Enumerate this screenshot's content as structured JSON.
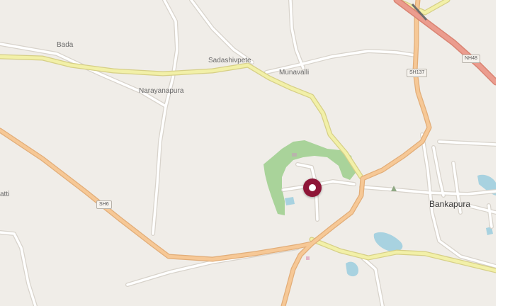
{
  "places": {
    "bada": "Bada",
    "sadashivpete": "Sadashivpete",
    "munavalli": "Munavalli",
    "narayanapura": "Narayanapura",
    "atti": "atti",
    "bankapura": "Bankapura"
  },
  "roads": {
    "sh6": "SH6",
    "sh137": "SH137",
    "nh48": "NH48"
  },
  "colors": {
    "land": "#f0ede8",
    "minor_road": "#ffffff",
    "primary_road": "#f6c896",
    "secondary_road": "#f2f0a8",
    "motorway": "#eb9c8e",
    "park": "#a9d39a",
    "water": "#a8d2e0",
    "marker": "#8e1537"
  },
  "marker": {
    "icon": "location-marker-icon"
  }
}
